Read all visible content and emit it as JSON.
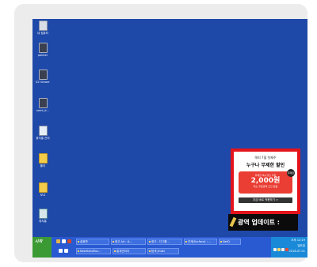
{
  "desktop": {
    "icons": [
      {
        "label": "내 컴퓨터",
        "icon": "my-computer-icon"
      },
      {
        "label": "pointer",
        "icon": "app-icon"
      },
      {
        "label": "EZ Viewer",
        "icon": "app-icon"
      },
      {
        "label": "semi_d...",
        "icon": "app-icon"
      },
      {
        "label": "휴지통 관리",
        "icon": "app-icon"
      },
      {
        "label": "폴더",
        "icon": "folder-icon"
      },
      {
        "label": "보고",
        "icon": "folder-icon"
      },
      {
        "label": "휴지통",
        "icon": "recycle-bin-icon"
      }
    ]
  },
  "popup": {
    "line1": "해피 7월 첫째주",
    "line2": "누구나 무제한 할인",
    "coupon_top": "무제한 즉시할인 쿠폰",
    "coupon_amount": "2,000원",
    "coupon_note": "최소 주문금액 조건 없음",
    "badge": "무제한",
    "button": "지금 바로 적용하기 >"
  },
  "ad_bar": {
    "label": "광역 업데이트 :"
  },
  "taskbar": {
    "start_label": "시작",
    "row1": [
      "설정판",
      "광고 Ad : 쇼...",
      "광고 : 다그룹...",
      "관계(Surface) : ...",
      "NetQ"
    ],
    "row2": [
      "NewHeadToo...",
      "통계관리자",
      "탐색 Jinaki"
    ],
    "clock": [
      "오후 12:19",
      "일요일",
      "2018-07-01"
    ],
    "colors": {
      "bar": "#2a5ad2",
      "start": "#3c9a34",
      "tray": "#1a8ad8",
      "desktop": "#1f49a8"
    }
  }
}
